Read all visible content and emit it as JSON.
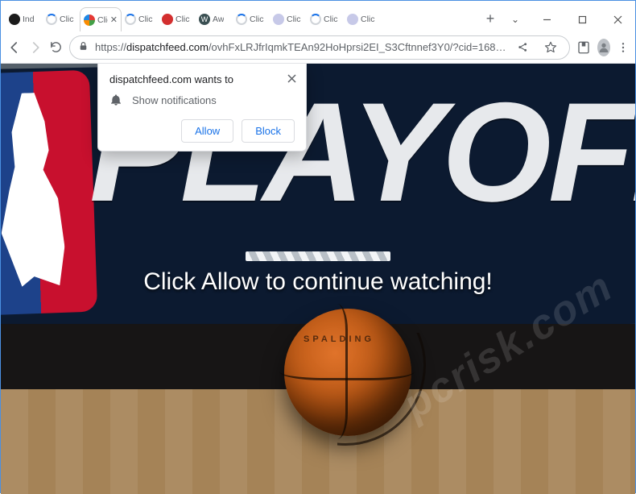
{
  "window": {
    "chevron": "⌄",
    "minimize_tip": "Minimize",
    "maximize_tip": "Maximize",
    "close_tip": "Close"
  },
  "tabs": {
    "items": [
      {
        "label": "Ind",
        "favicon": "dark"
      },
      {
        "label": "Clic",
        "favicon": "spin"
      },
      {
        "label": "Clic",
        "favicon": "dots",
        "active": true
      },
      {
        "label": "Clic",
        "favicon": "spin"
      },
      {
        "label": "Clic",
        "favicon": "red"
      },
      {
        "label": "Aw",
        "favicon": "w"
      },
      {
        "label": "Clic",
        "favicon": "spin"
      },
      {
        "label": "Clic",
        "favicon": "violet"
      },
      {
        "label": "Clic",
        "favicon": "spin"
      },
      {
        "label": "Clic",
        "favicon": "violet"
      }
    ],
    "new_tab_tip": "New tab"
  },
  "nav": {
    "back_tip": "Back",
    "forward_tip": "Forward",
    "reload_tip": "Reload",
    "share_tip": "Share",
    "star_tip": "Bookmark",
    "reading_tip": "Reading list",
    "profile_tip": "Profile",
    "menu_tip": "Menu"
  },
  "url": {
    "scheme": "https://",
    "host": "dispatchfeed.com",
    "path": "/ovhFxLRJfrIqmkTEAn92HoHprsi2EI_S3Cftnnef3Y0/?cid=168…"
  },
  "prompt": {
    "origin": "dispatchfeed.com",
    "wants_to": "wants to",
    "permission": "Show notifications",
    "allow": "Allow",
    "block": "Block"
  },
  "page": {
    "headline": "PLAYOFFS",
    "cta": "Click Allow to continue watching!",
    "ball_brand": "SPALDING",
    "watermark": "pcrisk.com"
  }
}
